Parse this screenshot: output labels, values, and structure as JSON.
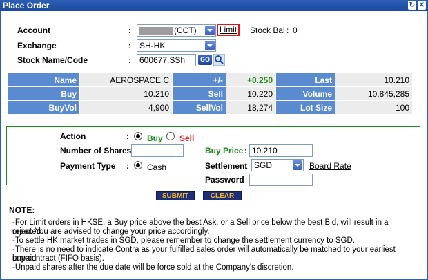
{
  "window": {
    "title": "Place Order"
  },
  "account": {
    "label": "Account",
    "value": "(CCT)",
    "order_type_link": "Limit",
    "stock_bal_label": "Stock Bal",
    "stock_bal_value": "0"
  },
  "exchange": {
    "label": "Exchange",
    "value": "SH-HK"
  },
  "stock": {
    "label": "Stock Name/Code",
    "code": "600677.SSh",
    "go_label": "GO"
  },
  "quote": {
    "name_label": "Name",
    "name_value": "AEROSPACE C",
    "change_label": "+/-",
    "change_value": "+0.250",
    "last_label": "Last",
    "last_value": "10.210",
    "buy_label": "Buy",
    "buy_value": "10.210",
    "sell_label": "Sell",
    "sell_value": "10.220",
    "volume_label": "Volume",
    "volume_value": "10,845,285",
    "buyvol_label": "BuyVol",
    "buyvol_value": "4,900",
    "sellvol_label": "SellVol",
    "sellvol_value": "18,274",
    "lotsize_label": "Lot Size",
    "lotsize_value": "100"
  },
  "order": {
    "action_label": "Action",
    "buy_option": "Buy",
    "sell_option": "Sell",
    "shares_label": "Number of Shares",
    "shares_value": "",
    "payment_label": "Payment Type",
    "payment_option": "Cash",
    "price_label": "Buy Price",
    "price_value": "10.210",
    "settlement_label": "Settlement",
    "settlement_value": "SGD",
    "board_rate_link": "Board Rate",
    "password_label": "Password",
    "password_value": ""
  },
  "buttons": {
    "submit": "SUBMIT",
    "clear": "CLEAR"
  },
  "note": {
    "title": "NOTE:",
    "lines": [
      "-For Limit orders in HKSE, a Buy price above the best Ask, or a Sell price below the best Bid, will result in a rejected",
      "order. You are advised to change your price accordingly.",
      "-To settle HK market trades in SGD, please remember to change the settlement currency to SGD.",
      "-There is no need to indicate Contra as your fulfilled sales order will automatically be matched to your earliest unpaid",
      "buy contract (FIFO basis).",
      "-Unpaid shares after the due date will be force sold at the Company's discretion."
    ]
  },
  "colors": {
    "title_bar": "#1b4aa0",
    "table_header": "#5a8ad0",
    "positive_change": "#1f8a1f",
    "sell_red": "#d8141e",
    "button_bg": "#1e2f7a",
    "button_text": "#f5b623",
    "highlight_border": "#e0141e"
  }
}
